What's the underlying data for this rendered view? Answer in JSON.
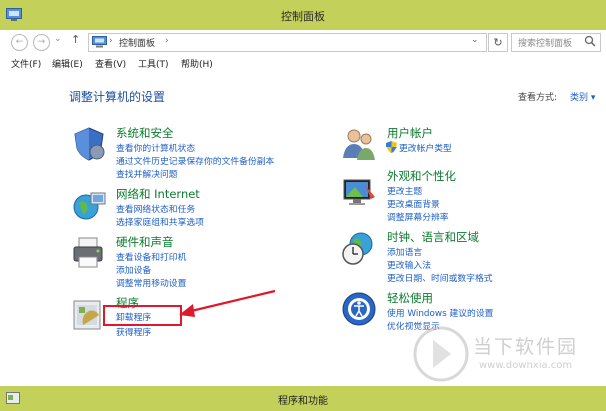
{
  "window": {
    "title": "控制面板"
  },
  "nav": {
    "back": "←",
    "forward": "→",
    "recent": "⌄",
    "up": "↑",
    "breadcrumb": "控制面板",
    "breadcrumb_sep": "›",
    "address_dropdown": "⌄",
    "refresh": "↻",
    "search_placeholder": "搜索控制面板"
  },
  "menu": [
    {
      "label": "文件(F)"
    },
    {
      "label": "编辑(E)"
    },
    {
      "label": "查看(V)"
    },
    {
      "label": "工具(T)"
    },
    {
      "label": "帮助(H)"
    }
  ],
  "main": {
    "heading": "调整计算机的设置",
    "view_by_label": "查看方式:",
    "view_by_value": "类别 ▾"
  },
  "categories_left": [
    {
      "title": "系统和安全",
      "links": [
        "查看你的计算机状态",
        "通过文件历史记录保存你的文件备份副本",
        "查找并解决问题"
      ]
    },
    {
      "title": "网络和 Internet",
      "links": [
        "查看网络状态和任务",
        "选择家庭组和共享选项"
      ]
    },
    {
      "title": "硬件和声音",
      "links": [
        "查看设备和打印机",
        "添加设备",
        "调整常用移动设置"
      ]
    },
    {
      "title": "程序",
      "links": [
        "卸载程序",
        "获得程序"
      ]
    }
  ],
  "categories_right": [
    {
      "title": "用户帐户",
      "links": [
        "更改帐户类型"
      ]
    },
    {
      "title": "外观和个性化",
      "links": [
        "更改主题",
        "更改桌面背景",
        "调整屏幕分辨率"
      ]
    },
    {
      "title": "时钟、语言和区域",
      "links": [
        "添加语言",
        "更改输入法",
        "更改日期、时间或数字格式"
      ]
    },
    {
      "title": "轻松使用",
      "links": [
        "使用 Windows 建议的设置",
        "优化视觉显示"
      ]
    }
  ],
  "bottom": {
    "title": "程序和功能"
  },
  "watermark": {
    "brand": "当下软件园",
    "url": "www.downxia.com"
  },
  "colors": {
    "titlebar": "#c3d05a",
    "link": "#1e5fc8",
    "category": "#0b7b2e",
    "annotation": "#e0182b"
  }
}
